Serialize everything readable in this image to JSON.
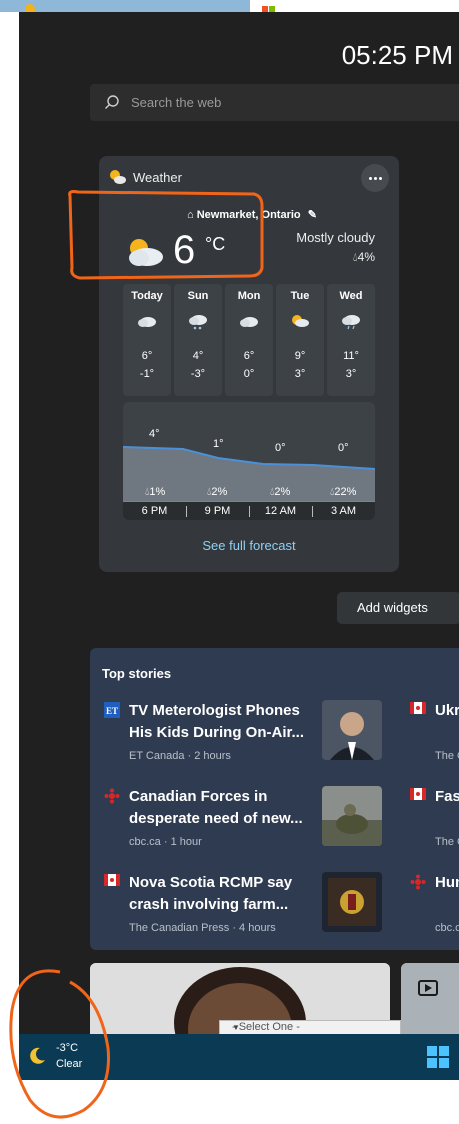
{
  "window": {
    "clock": "05:25 PM"
  },
  "search": {
    "placeholder": "Search the web"
  },
  "weather": {
    "title": "Weather",
    "location": "Newmarket, Ontario",
    "temp": "6",
    "unit": "°C",
    "condition": "Mostly cloudy",
    "precip": "4%",
    "days": [
      {
        "name": "Today",
        "hi": "6°",
        "lo": "-1°",
        "icon": "cloudy-icon"
      },
      {
        "name": "Sun",
        "hi": "4°",
        "lo": "-3°",
        "icon": "snow-cloud-icon"
      },
      {
        "name": "Mon",
        "hi": "6°",
        "lo": "0°",
        "icon": "cloudy-icon"
      },
      {
        "name": "Tue",
        "hi": "9°",
        "lo": "3°",
        "icon": "partly-sunny-icon"
      },
      {
        "name": "Wed",
        "hi": "11°",
        "lo": "3°",
        "icon": "rain-cloud-icon"
      }
    ],
    "hourly": [
      {
        "time": "6 PM",
        "temp": "4°",
        "precip": "1%"
      },
      {
        "time": "9 PM",
        "temp": "1°",
        "precip": "2%"
      },
      {
        "time": "12 AM",
        "temp": "0°",
        "precip": "2%"
      },
      {
        "time": "3 AM",
        "temp": "0°",
        "precip": "22%"
      }
    ],
    "full_forecast": "See full forecast"
  },
  "add_widgets": "Add widgets",
  "top_stories": {
    "title": "Top stories",
    "items": [
      {
        "headline": "TV Meterologist Phones His Kids During On-Air...",
        "meta": "ET Canada · 2 hours"
      },
      {
        "headline": "Canadian Forces in desperate need of new...",
        "meta": "cbc.ca · 1 hour"
      },
      {
        "headline": "Nova Scotia RCMP say crash involving farm...",
        "meta": "The Canadian Press · 4 hours"
      }
    ],
    "right_items": [
      {
        "headline": "Ukr area",
        "meta": "The C"
      },
      {
        "headline": "Fast Pati",
        "meta": "The C"
      },
      {
        "headline": "Hun rela",
        "meta": "cbc.c"
      }
    ]
  },
  "select": {
    "value": "- Select One -"
  },
  "taskbar": {
    "temp": "-3°C",
    "condition": "Clear"
  },
  "colors": {
    "panel": "#202020",
    "card": "#34383c",
    "stories": "#2e3b50",
    "taskbar": "#0b3a55",
    "link": "#8fd0f5"
  }
}
